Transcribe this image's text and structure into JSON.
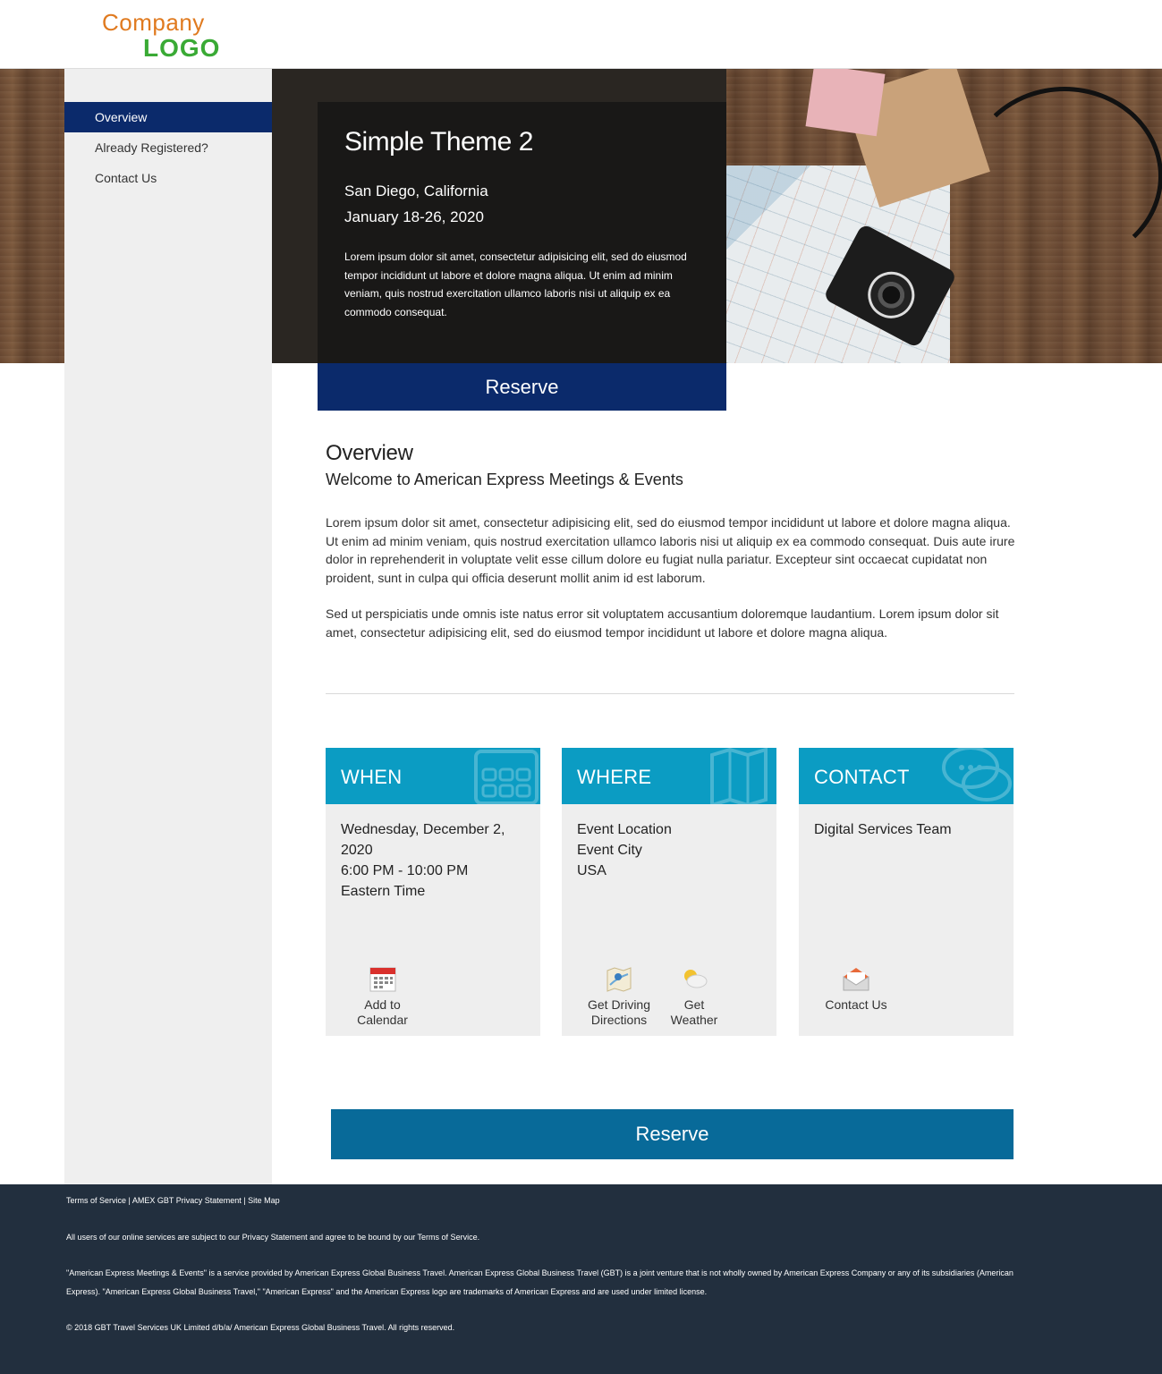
{
  "header": {
    "logo_line1": "Company",
    "logo_line2": "LOGO"
  },
  "sidebar": {
    "items": [
      {
        "label": "Overview",
        "active": true
      },
      {
        "label": "Already Registered?"
      },
      {
        "label": "Contact Us"
      }
    ]
  },
  "hero": {
    "title": "Simple Theme 2",
    "location": "San Diego, California",
    "dates": "January 18-26, 2020",
    "description": "Lorem ipsum dolor sit amet, consectetur adipisicing elit, sed do eiusmod tempor incididunt ut labore et dolore magna aliqua. Ut enim ad minim veniam, quis nostrud exercitation ullamco laboris nisi ut aliquip ex ea commodo consequat.",
    "reserve_label": "Reserve"
  },
  "overview": {
    "heading": "Overview",
    "subheading": "Welcome to American Express Meetings & Events",
    "paragraph1": "Lorem ipsum dolor sit amet, consectetur adipisicing elit, sed do eiusmod tempor incididunt ut labore et dolore magna aliqua. Ut enim ad minim veniam, quis nostrud exercitation ullamco laboris nisi ut aliquip ex ea commodo consequat. Duis aute irure dolor in reprehenderit in voluptate velit esse cillum dolore eu fugiat nulla pariatur. Excepteur sint occaecat cupidatat non proident, sunt in culpa qui officia deserunt mollit anim id est laborum.",
    "paragraph2": "Sed ut perspiciatis unde omnis iste natus error sit voluptatem accusantium doloremque laudantium. Lorem ipsum dolor sit amet, consectetur adipisicing elit, sed do eiusmod tempor incididunt ut labore et dolore magna aliqua."
  },
  "cards": {
    "when": {
      "title": "WHEN",
      "lines": [
        "Wednesday, December 2,",
        "2020",
        "6:00 PM - 10:00 PM",
        "Eastern Time"
      ],
      "action_add_calendar": "Add to\nCalendar"
    },
    "where": {
      "title": "WHERE",
      "lines": [
        "Event Location",
        "Event City",
        "USA"
      ],
      "action_directions": "Get Driving\nDirections",
      "action_weather": "Get\nWeather"
    },
    "contact": {
      "title": "CONTACT",
      "lines": [
        "Digital Services Team"
      ],
      "action_contact": "Contact Us"
    }
  },
  "reserve_bottom_label": "Reserve",
  "footer": {
    "link_terms": "Terms of Service",
    "link_privacy": "AMEX GBT Privacy Statement",
    "link_sitemap": "Site Map",
    "separator": " | ",
    "para1": "All users of our online services are subject to our Privacy Statement and agree to be bound by our Terms of Service.",
    "para2": "\"American Express Meetings & Events\" is a service provided by American Express Global Business Travel. American Express Global Business Travel (GBT) is a joint venture that is not wholly owned by American Express Company or any of its subsidiaries (American Express). \"American Express Global Business Travel,\" \"American Express\" and the American Express logo are trademarks of American Express and are used under limited license.",
    "para3": "© 2018 GBT Travel Services UK Limited d/b/a/ American Express Global Business Travel. All rights reserved."
  },
  "colors": {
    "nav_active": "#0b2a6b",
    "card_header": "#0b9cc3",
    "reserve_bottom": "#086a99",
    "footer_bg": "#222f3e"
  }
}
